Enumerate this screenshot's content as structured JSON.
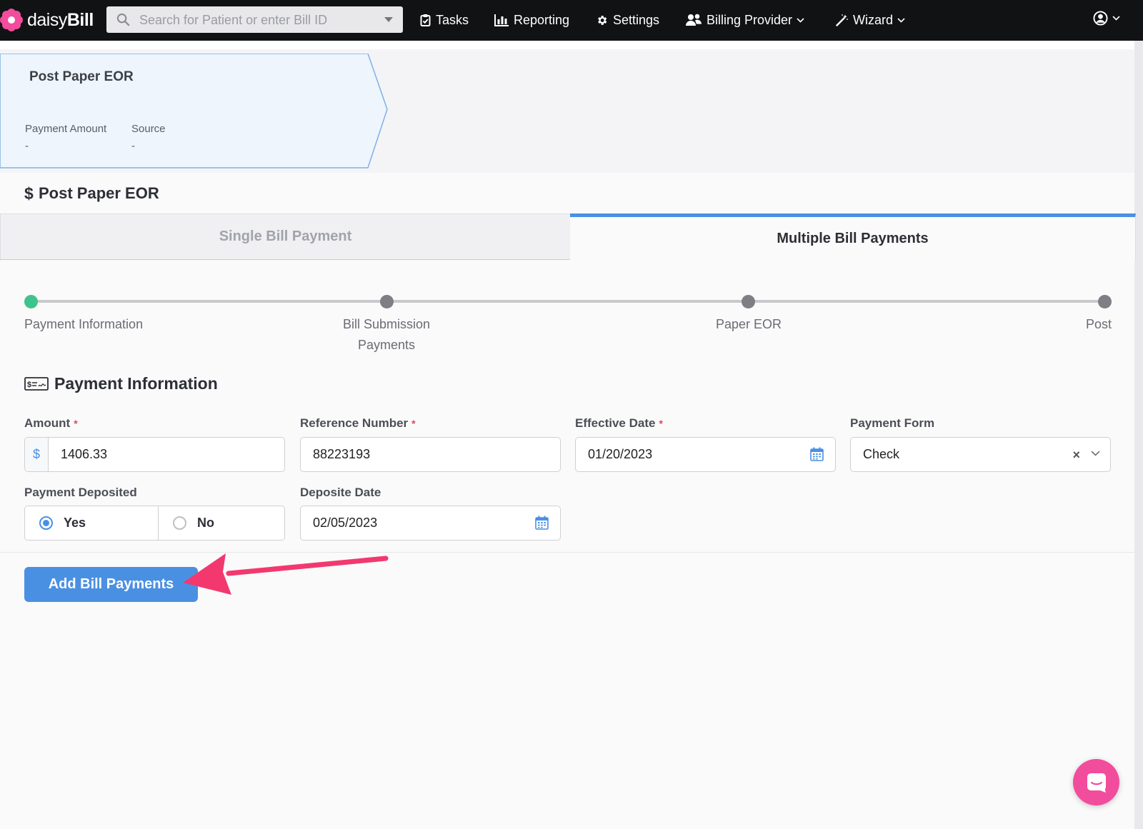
{
  "nav": {
    "logo_light": "daisy",
    "logo_bold": "Bill",
    "search_placeholder": "Search for Patient or enter Bill ID",
    "items": [
      {
        "label": "Tasks",
        "icon": "clipboard-check-icon"
      },
      {
        "label": "Reporting",
        "icon": "bar-chart-icon"
      },
      {
        "label": "Settings",
        "icon": "gear-icon"
      },
      {
        "label": "Billing Provider",
        "icon": "users-icon"
      },
      {
        "label": "Wizard",
        "icon": "magic-wand-icon"
      }
    ]
  },
  "eor_card": {
    "title": "Post Paper EOR",
    "payment_amount_label": "Payment Amount",
    "payment_amount_value": "-",
    "source_label": "Source",
    "source_value": "-"
  },
  "section_title": "Post Paper EOR",
  "tabs": {
    "single": "Single Bill Payment",
    "multiple": "Multiple Bill Payments",
    "active": "multiple"
  },
  "stepper": {
    "steps": [
      "Payment Information",
      "Bill Submission Payments",
      "Paper EOR",
      "Post"
    ],
    "step2_line1": "Bill Submission",
    "step2_line2": "Payments",
    "current_step": 1
  },
  "payment_info": {
    "title": "Payment Information",
    "amount_label": "Amount",
    "amount_prefix": "$",
    "amount_value": "1406.33",
    "reference_label": "Reference Number",
    "reference_value": "88223193",
    "effective_date_label": "Effective Date",
    "effective_date_value": "01/20/2023",
    "payment_form_label": "Payment Form",
    "payment_form_value": "Check",
    "deposited_label": "Payment Deposited",
    "deposited_yes": "Yes",
    "deposited_no": "No",
    "deposited_selected": "Yes",
    "deposite_date_label": "Deposite Date",
    "deposite_date_value": "02/05/2023",
    "required_marker": "*"
  },
  "actions": {
    "add_bill_payments": "Add Bill Payments"
  },
  "colors": {
    "accent": "#4a90e2",
    "active_step": "#3fc38c",
    "annotation_arrow": "#f2386f",
    "chat": "#f24c9d"
  }
}
